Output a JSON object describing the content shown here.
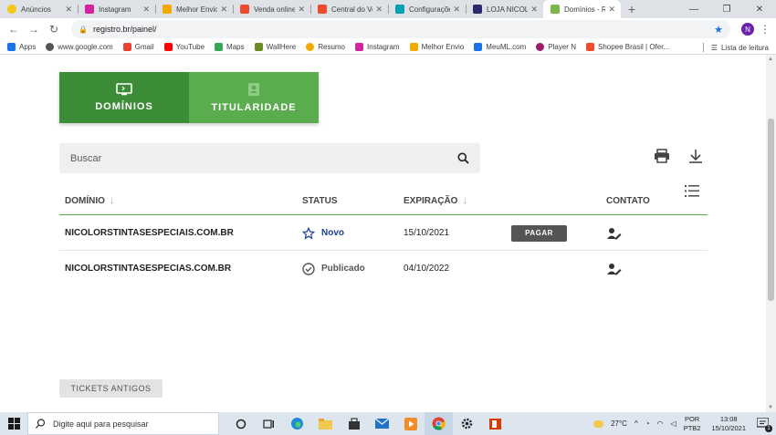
{
  "browser": {
    "tabs": [
      {
        "title": "Anúncios",
        "color": "#f5c518"
      },
      {
        "title": "Instagram",
        "color": "#d6249f"
      },
      {
        "title": "Melhor Envio",
        "color": "#f2a900"
      },
      {
        "title": "Venda online",
        "color": "#ee4d2d"
      },
      {
        "title": "Central do Ve",
        "color": "#ee4d2d"
      },
      {
        "title": "Configuraçõe",
        "color": "#00a3b4"
      },
      {
        "title": "LOJA NICOLO",
        "color": "#2b2b6b"
      },
      {
        "title": "Domínios - R",
        "color": "#7ab648"
      }
    ],
    "url": "registro.br/painel/",
    "profile_initial": "N",
    "bookmarks": [
      {
        "label": "Apps",
        "color": "#1a73e8"
      },
      {
        "label": "www.google.com",
        "color": "#555"
      },
      {
        "label": "Gmail",
        "color": "#ea4335"
      },
      {
        "label": "YouTube",
        "color": "#ff0000"
      },
      {
        "label": "Maps",
        "color": "#34a853"
      },
      {
        "label": "WallHere",
        "color": "#6b8e23"
      },
      {
        "label": "Resumo",
        "color": "#f2a900"
      },
      {
        "label": "Instagram",
        "color": "#d6249f"
      },
      {
        "label": "Melhor Envio",
        "color": "#f2a900"
      },
      {
        "label": "MeuML.com",
        "color": "#1a73e8"
      },
      {
        "label": "Player N",
        "color": "#9b1b6e"
      },
      {
        "label": "Shopee Brasil | Ofer...",
        "color": "#ee4d2d"
      }
    ],
    "reading_list": "Lista de leitura"
  },
  "page": {
    "tabs": {
      "domains": "DOMÍNIOS",
      "ownership": "TITULARIDADE"
    },
    "search_placeholder": "Buscar",
    "table": {
      "headers": {
        "domain": "DOMÍNIO",
        "status": "STATUS",
        "expiry": "EXPIRAÇÃO",
        "contact": "CONTATO"
      },
      "rows": [
        {
          "domain": "NICOLORSTINTASESPECIAIS.COM.BR",
          "status": "Novo",
          "expiry": "15/10/2021",
          "action": "PAGAR"
        },
        {
          "domain": "NICOLORSTINTASESPECIAS.COM.BR",
          "status": "Publicado",
          "expiry": "04/10/2022",
          "action": ""
        }
      ]
    },
    "old_tickets": "TICKETS ANTIGOS",
    "colors": {
      "green_dark": "#3d8c38",
      "green_light": "#5aac4f",
      "status_new": "#1a3d8f"
    }
  },
  "taskbar": {
    "search_placeholder": "Digite aqui para pesquisar",
    "weather": "27°C",
    "lang_line1": "POR",
    "lang_line2": "PTB2",
    "time": "13:08",
    "date": "15/10/2021",
    "notifications": "1"
  }
}
